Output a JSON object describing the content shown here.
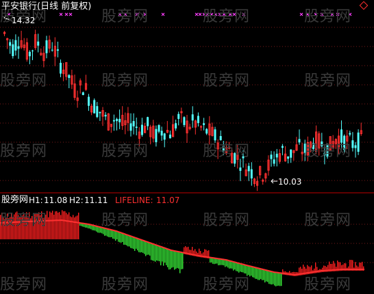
{
  "chart_title": "平安银行(日线 前复权)",
  "watermark_text": "股旁网",
  "price_high_label": "14.32",
  "price_low_label": "10.03",
  "indicator": {
    "name": "股旁网",
    "h1_label": "H1:",
    "h1_value": "11.08",
    "h2_label": "H2:",
    "h2_value": "11.11",
    "lifeline_label": "LIFELINE:",
    "lifeline_value": "11.07"
  },
  "colors": {
    "background": "#000000",
    "up_candle": "#ff3030",
    "down_candle": "#54ffff",
    "signal_marker": "#ff40ff",
    "grid_dots": "#7a1a1a",
    "separator": "#c00000",
    "title": "#ffffff",
    "indicator_h": "#ffffff",
    "lifeline": "#ff3030",
    "green_bars": "#38e838",
    "red_bars": "#ff2020",
    "watermark": "#3a3a3a"
  },
  "chart_data": {
    "type": "candlestick",
    "title": "平安银行(日线 前复权)",
    "price_annotations": [
      {
        "label": "14.32",
        "type": "high"
      },
      {
        "label": "10.03",
        "type": "low"
      }
    ],
    "close_path": [
      14.0,
      13.6,
      13.9,
      13.4,
      13.8,
      13.5,
      13.7,
      13.2,
      12.9,
      12.4,
      12.6,
      12.1,
      11.9,
      11.6,
      11.7,
      11.5,
      11.6,
      11.4,
      11.5,
      11.2,
      11.4,
      11.3,
      11.7,
      11.5,
      11.6,
      11.4,
      11.3,
      11.1,
      10.9,
      10.7,
      10.5,
      10.3,
      10.1,
      10.3,
      10.6,
      10.8,
      10.7,
      10.9,
      10.8,
      11.1,
      11.0,
      10.9,
      11.2,
      11.1,
      11.0,
      11.1
    ],
    "indicator": {
      "h1": 11.08,
      "h2": 11.11,
      "lifeline": 11.07,
      "bars": [
        "red",
        "red",
        "red",
        "red",
        "red",
        "green",
        "green",
        "green",
        "green",
        "green",
        "green",
        "green",
        "mixed",
        "red",
        "green",
        "green",
        "green",
        "green",
        "green",
        "green",
        "mixed",
        "red",
        "red",
        "red"
      ]
    }
  }
}
